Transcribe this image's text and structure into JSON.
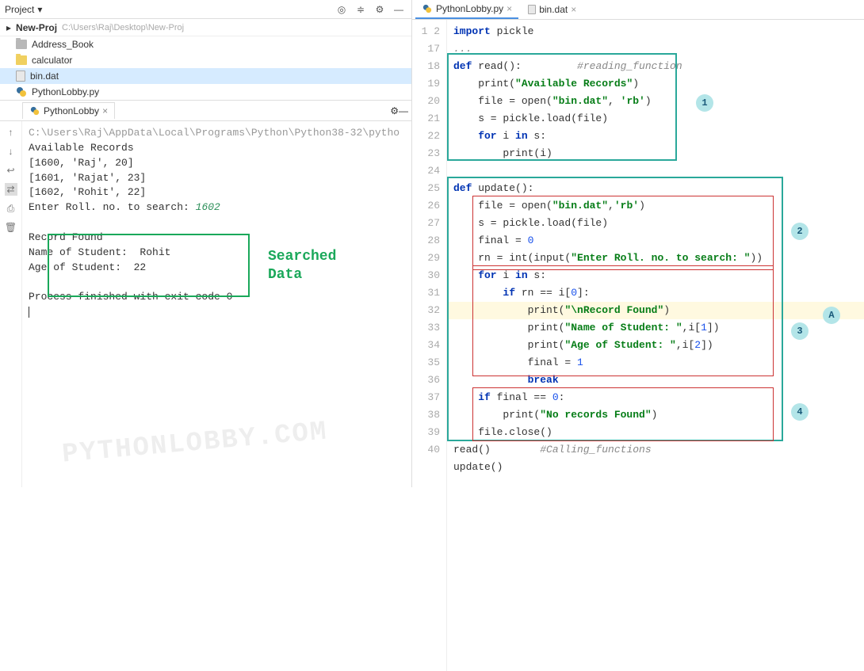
{
  "project": {
    "header_title": "Project",
    "name": "New-Proj",
    "path": "C:\\Users\\Raj\\Desktop\\New-Proj"
  },
  "tree": {
    "items": [
      {
        "label": "Address_Book",
        "type": "folder"
      },
      {
        "label": "calculator",
        "type": "folder-yellow"
      },
      {
        "label": "bin.dat",
        "type": "file",
        "selected": true
      },
      {
        "label": "PythonLobby.py",
        "type": "py"
      }
    ]
  },
  "console": {
    "tab_label": "PythonLobby",
    "gutter_icons": [
      "up-arrow",
      "down-arrow",
      "back-arrow",
      "wrap",
      "print",
      "trash"
    ],
    "path_line": "C:\\Users\\Raj\\AppData\\Local\\Programs\\Python\\Python38-32\\pytho",
    "output_lines": [
      "Available Records",
      "[1600, 'Raj', 20]",
      "[1601, 'Rajat', 23]",
      "[1602, 'Rohit', 22]"
    ],
    "prompt_text": "Enter Roll. no. to search: ",
    "prompt_input": "1602",
    "result_lines": [
      "",
      "Record Found",
      "Name of Student:  Rohit",
      "Age of Student:  22"
    ],
    "exit_line": "Process finished with exit code 0",
    "box_label_line1": "Searched",
    "box_label_line2": "Data"
  },
  "editor": {
    "tabs": [
      {
        "label": "PythonLobby.py",
        "active": true
      },
      {
        "label": "bin.dat",
        "active": false
      }
    ],
    "line_numbers": [
      "1",
      "2",
      "17",
      "18",
      "19",
      "20",
      "21",
      "22",
      "23",
      "24",
      "25",
      "26",
      "27",
      "28",
      "29",
      "30",
      "31",
      "32",
      "33",
      "34",
      "35",
      "36",
      "37",
      "38",
      "39",
      "40"
    ],
    "code_tokens": {
      "l1_import": "import",
      "l1_pickle": " pickle",
      "l2_fold": "...",
      "l17_def": "def",
      "l17_name": " read():",
      "l17_cmt": "         #reading_function",
      "l18_pr": "    print(",
      "l18_str": "\"Available Records\"",
      "l18_close": ")",
      "l19_txt1": "    file = open(",
      "l19_str": "\"bin.dat\"",
      "l19_txt2": ", ",
      "l19_str2": "'rb'",
      "l19_txt3": ")",
      "l20_txt": "    s = pickle.load(file)",
      "l21_for": "    for",
      "l21_txt": " i ",
      "l21_in": "in",
      "l21_txt2": " s:",
      "l22_txt": "        print(i)",
      "l24_def": "def",
      "l24_name": " update():",
      "l25_txt1": "    file = open(",
      "l25_str": "\"bin.dat\"",
      "l25_txt2": ",",
      "l25_str2": "'rb'",
      "l25_txt3": ")",
      "l26_txt": "    s = pickle.load(file)",
      "l27_txt": "    final = ",
      "l27_num": "0",
      "l28_txt1": "    rn = int(input(",
      "l28_str": "\"Enter Roll. no. to search: \"",
      "l28_txt2": "))",
      "l29_for": "    for",
      "l29_txt": " i ",
      "l29_in": "in",
      "l29_txt2": " s:",
      "l30_if": "        if",
      "l30_txt": " rn == i[",
      "l30_num": "0",
      "l30_txt2": "]:",
      "l31_txt1": "            print(",
      "l31_str": "\"\\nRecord Found\"",
      "l31_txt2": ")",
      "l32_txt1": "            print(",
      "l32_str": "\"Name of Student: \"",
      "l32_txt2": ",i[",
      "l32_num": "1",
      "l32_txt3": "])",
      "l33_txt1": "            print(",
      "l33_str": "\"Age of Student: \"",
      "l33_txt2": ",i[",
      "l33_num": "2",
      "l33_txt3": "])",
      "l34_txt": "            final = ",
      "l34_num": "1",
      "l35_break": "            break",
      "l36_if": "    if",
      "l36_txt": " final == ",
      "l36_num": "0",
      "l36_txt2": ":",
      "l37_txt1": "        print(",
      "l37_str": "\"No records Found\"",
      "l37_txt2": ")",
      "l38_txt": "    file.close()",
      "l39_txt": "read()",
      "l39_cmt": "        #Calling_functions",
      "l40_txt": "update()"
    },
    "circles": {
      "c1": "1",
      "c2": "2",
      "c3": "3",
      "c4": "4",
      "cA": "A"
    }
  },
  "watermark": "PYTHONLOBBY.COM"
}
